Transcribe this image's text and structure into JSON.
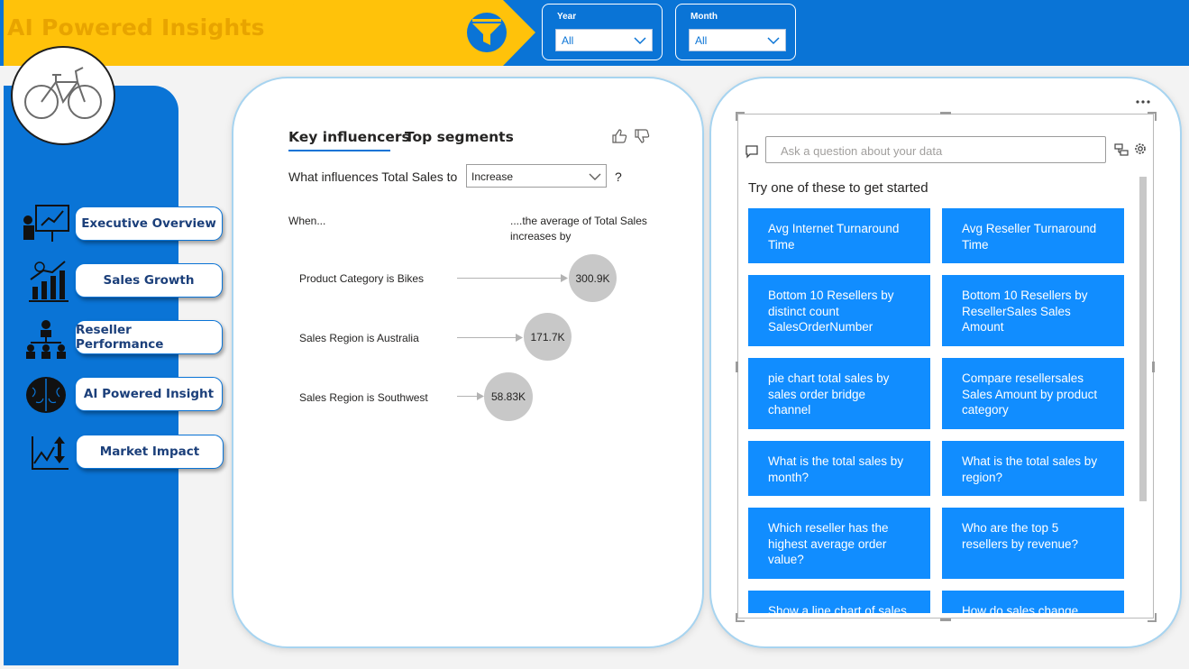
{
  "header": {
    "title": "AI Powered Insights",
    "slicers": [
      {
        "label": "Year",
        "value": "All"
      },
      {
        "label": "Month",
        "value": "All"
      }
    ]
  },
  "nav": {
    "items": [
      {
        "label": "Executive Overview",
        "icon": "presentation-chart-icon"
      },
      {
        "label": "Sales Growth",
        "icon": "bar-growth-icon"
      },
      {
        "label": "Reseller Performance",
        "icon": "org-hierarchy-icon"
      },
      {
        "label": "AI Powered Insight",
        "icon": "brain-icon"
      },
      {
        "label": "Market Impact",
        "icon": "line-arrows-icon"
      }
    ]
  },
  "key_influencers": {
    "tabs": [
      "Key influencers",
      "Top segments"
    ],
    "question_prefix": "What influences Total Sales to",
    "question_value": "Increase",
    "question_suffix": "?",
    "col_when": "When...",
    "col_avg_line1": "....the average of Total Sales",
    "col_avg_line2": "increases by",
    "rows": [
      {
        "label": "Product Category is Bikes",
        "value": "300.9K"
      },
      {
        "label": "Sales Region is Australia",
        "value": "171.7K"
      },
      {
        "label": "Sales Region is Southwest",
        "value": "58.83K"
      }
    ]
  },
  "qa": {
    "placeholder": "Ask a question about your data",
    "hint": "Try one of these to get started",
    "suggestions": [
      "Avg Internet Turnaround Time",
      "Avg Reseller Turnaround Time",
      "Bottom 10 Resellers by distinct count SalesOrderNumber",
      "Bottom 10 Resellers by ResellerSales Sales Amount",
      "pie chart total sales by sales order bridge channel",
      "Compare resellersales Sales Amount by product category",
      "What is the total sales by month?",
      "What is the total sales by region?",
      "Which reseller has the highest average order value?",
      "Who are the top 5 resellers by revenue?",
      "Show a line chart of sales",
      "How do sales change"
    ],
    "more_icon": "more-options-icon"
  },
  "colors": {
    "brand_blue": "#0a74d6",
    "brand_yellow": "#ffc20a",
    "title_text": "#e8a400",
    "suggestion_blue": "#118dff",
    "bubble_grey": "#c8c8c8"
  }
}
